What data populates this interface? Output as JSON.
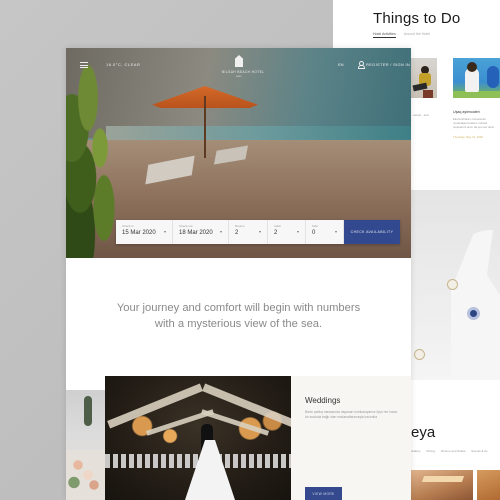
{
  "back_page": {
    "title": "Things to Do",
    "tabs": [
      {
        "label": "Hotel Activities",
        "active": true
      },
      {
        "label": "Around the Hotel",
        "active": false
      }
    ],
    "activity": {
      "title": "Uşaq aylencaleri",
      "description": "Elementhalum consectetur moderaljeprovident molinell poupalrunt anim da quo aur dolor",
      "date": "Thursday, May 21, 2020"
    },
    "left_snippet": "...actual\n...tual",
    "section_title_partial": "eya",
    "section_nav": [
      "Gallery",
      "Dining",
      "Rooms and Suites",
      "Events & Ac"
    ]
  },
  "header": {
    "weather": "16.0°C, CLEAR",
    "logo_name": "BILGAH BEACH HOTEL",
    "logo_sub": "BAKU",
    "language": "EN",
    "account_link": "REGISTER / SIGN IN"
  },
  "booking": {
    "fields": [
      {
        "label": "Check in",
        "value": "15 Mar 2020"
      },
      {
        "label": "Check out",
        "value": "18 Mar 2020"
      },
      {
        "label": "Rooms",
        "value": "2"
      },
      {
        "label": "Adult",
        "value": "2"
      },
      {
        "label": "Kids",
        "value": "0"
      }
    ],
    "button_label": "CHECK AVAILABILITY"
  },
  "tagline": {
    "line1": "Your journey and comfort will begin with numbers",
    "line2": "with a mysterious view of the sea."
  },
  "weddings": {
    "title": "Weddings",
    "description": "Bizim şadlıq masasında dayanan kombaniyamız İşlər her hansı bir suahola bağlı olan malumatlarımaqla hazırdıla",
    "button_label": "VIEW MORE"
  },
  "colors": {
    "primary": "#33498f",
    "accent_gold": "#d1b567",
    "text_dark": "#333333"
  }
}
